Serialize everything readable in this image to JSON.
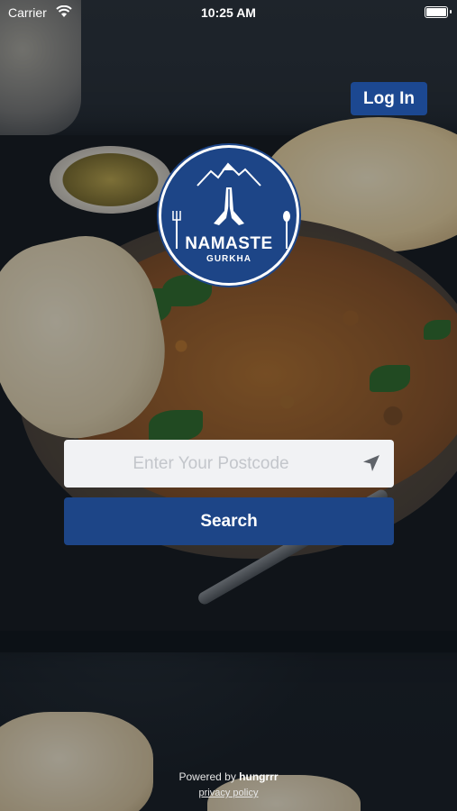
{
  "status_bar": {
    "carrier": "Carrier",
    "time": "10:25 AM"
  },
  "header": {
    "login_label": "Log In"
  },
  "logo": {
    "title": "NAMASTE",
    "subtitle": "GURKHA"
  },
  "search": {
    "placeholder": "Enter Your Postcode",
    "value": "",
    "button_label": "Search",
    "location_icon": "navigation-arrow-icon"
  },
  "footer": {
    "powered_prefix": "Powered by ",
    "brand": "hungrrr",
    "privacy_label": "privacy policy"
  },
  "colors": {
    "accent": "#1d4587",
    "input_bg": "#f1f2f4",
    "text_light": "#ffffff"
  }
}
